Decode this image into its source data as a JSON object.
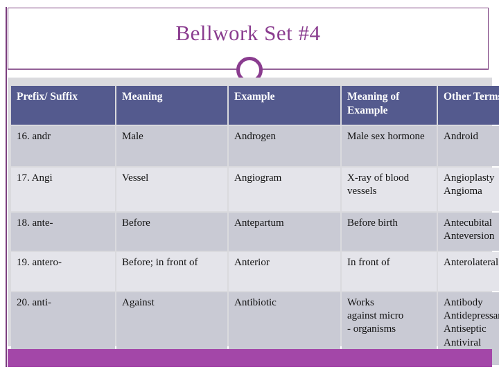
{
  "slide": {
    "title": "Bellwork Set #4",
    "accent_color": "#8a3c8f",
    "header_color": "#545a8e",
    "row_dark_color": "#c9cad4",
    "row_light_color": "#e4e4ea",
    "bottom_bar_color": "#a347a8",
    "band_color": "#dadade"
  },
  "table": {
    "headers": [
      "Prefix/ Suffix",
      "Meaning",
      "Example",
      "Meaning of Example",
      "Other Terms"
    ],
    "rows": [
      {
        "prefix_suffix": "16. andr",
        "meaning": "Male",
        "example": "Androgen",
        "meaning_of_example": "Male sex hormone",
        "other_terms": "Android"
      },
      {
        "prefix_suffix": "17. Angi",
        "meaning": "Vessel",
        "example": "Angiogram",
        "meaning_of_example": "X-ray of blood vessels",
        "other_terms": "Angioplasty\nAngioma"
      },
      {
        "prefix_suffix": "18. ante-",
        "meaning": "Before",
        "example": "Antepartum",
        "meaning_of_example": "Before birth",
        "other_terms": "Antecubital\nAnteversion"
      },
      {
        "prefix_suffix": "19. antero-",
        "meaning": "Before; in front of",
        "example": "Anterior",
        "meaning_of_example": "In front of",
        "other_terms": "Anterolateral"
      },
      {
        "prefix_suffix": "20. anti-",
        "meaning": "Against",
        "example": "Antibiotic",
        "meaning_of_example": "Works\nagainst micro\n-  organisms",
        "other_terms": "Antibody\nAntidepressant\nAntiseptic\nAntiviral"
      }
    ]
  }
}
